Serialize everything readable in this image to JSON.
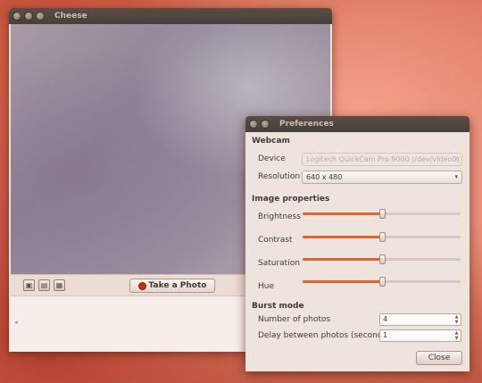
{
  "cheese": {
    "title": "Cheese",
    "take_photo_label": "Take a Photo",
    "mode_buttons": [
      {
        "name": "photo-mode-icon",
        "glyph": "▣"
      },
      {
        "name": "video-mode-icon",
        "glyph": "▤"
      },
      {
        "name": "burst-mode-icon",
        "glyph": "▦"
      }
    ],
    "thumb_scroll_glyph": "◂"
  },
  "preferences": {
    "title": "Preferences",
    "webcam_section": "Webcam",
    "device_label": "Device",
    "device_value": "Logitech QuickCam Pro 9000 (/dev/video0)",
    "resolution_label": "Resolution",
    "resolution_value": "640 x 480",
    "image_section": "Image properties",
    "brightness_label": "Brightness",
    "contrast_label": "Contrast",
    "saturation_label": "Saturation",
    "hue_label": "Hue",
    "burst_section": "Burst mode",
    "num_photos_label": "Number of photos",
    "num_photos_value": "4",
    "delay_label": "Delay between photos (seconds)",
    "delay_value": "1",
    "close_label": "Close"
  },
  "sliders": {
    "brightness": 0.5,
    "contrast": 0.5,
    "saturation": 0.5,
    "hue": 0.5
  },
  "colors": {
    "accent": "#e0642f",
    "record": "#d02b16"
  }
}
